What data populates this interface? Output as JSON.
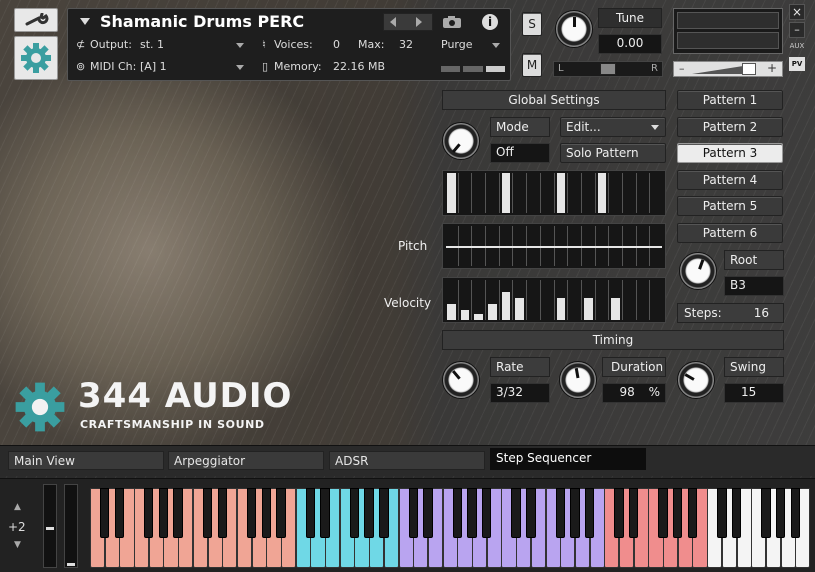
{
  "header": {
    "instrument_name": "Shamanic Drums PERC",
    "output_label": "Output:",
    "output_value": "st. 1",
    "voices_label": "Voices:",
    "voices_value": "0",
    "max_label": "Max:",
    "max_value": "32",
    "purge_label": "Purge",
    "midi_label": "MIDI Ch:",
    "midi_value": "[A]  1",
    "memory_label": "Memory:",
    "memory_value": "22.16 MB",
    "solo_label": "S",
    "mute_label": "M",
    "tune_label": "Tune",
    "tune_value": "0.00",
    "pan_left": "L",
    "pan_right": "R",
    "aux_label": "AUX",
    "pv_label": "PV",
    "close_glyph": "×",
    "minimize_glyph": "–",
    "volume_minus": "–",
    "volume_plus": "+"
  },
  "brand": {
    "name": "344 AUDIO",
    "tagline": "CRAFTSMANSHIP IN SOUND"
  },
  "global": {
    "title": "Global Settings",
    "mode_label": "Mode",
    "mode_value": "Off",
    "edit_label": "Edit...",
    "solo_pattern_label": "Solo Pattern",
    "pitch_label": "Pitch",
    "velocity_label": "Velocity"
  },
  "patterns": [
    "Pattern 1",
    "Pattern 2",
    "Pattern 3",
    "Pattern 4",
    "Pattern 5",
    "Pattern 6"
  ],
  "active_pattern": "Pattern 3",
  "root": {
    "label": "Root",
    "value": "B3"
  },
  "steps": {
    "label": "Steps:",
    "value": "16"
  },
  "timing": {
    "title": "Timing",
    "rate_label": "Rate",
    "rate_value": "3/32",
    "duration_label": "Duration",
    "duration_value": "98",
    "duration_unit": "%",
    "swing_label": "Swing",
    "swing_value": "15"
  },
  "sequencer": {
    "gate": [
      1,
      0,
      0,
      0,
      1,
      0,
      0,
      0,
      1,
      0,
      0,
      1,
      0,
      0,
      0,
      0
    ],
    "velocity": [
      0.4,
      0.25,
      0.15,
      0.4,
      0.7,
      0.55,
      0,
      0,
      0.55,
      0,
      0.55,
      0,
      0.55,
      0,
      0,
      0
    ]
  },
  "tabs": [
    "Main View",
    "Arpeggiator",
    "ADSR",
    "Step Sequencer"
  ],
  "active_tab": "Step Sequencer",
  "keyboard": {
    "octave_shift": "+2",
    "up_glyph": "▲",
    "down_glyph": "▼"
  },
  "colors": {
    "zone_orange": "#f0a595",
    "zone_cyan": "#6fd8e6",
    "zone_purple": "#b9a4f0",
    "zone_red": "#f08d8d",
    "white_key": "#f4f4f4",
    "accent_gear": "#3a9ea0"
  }
}
